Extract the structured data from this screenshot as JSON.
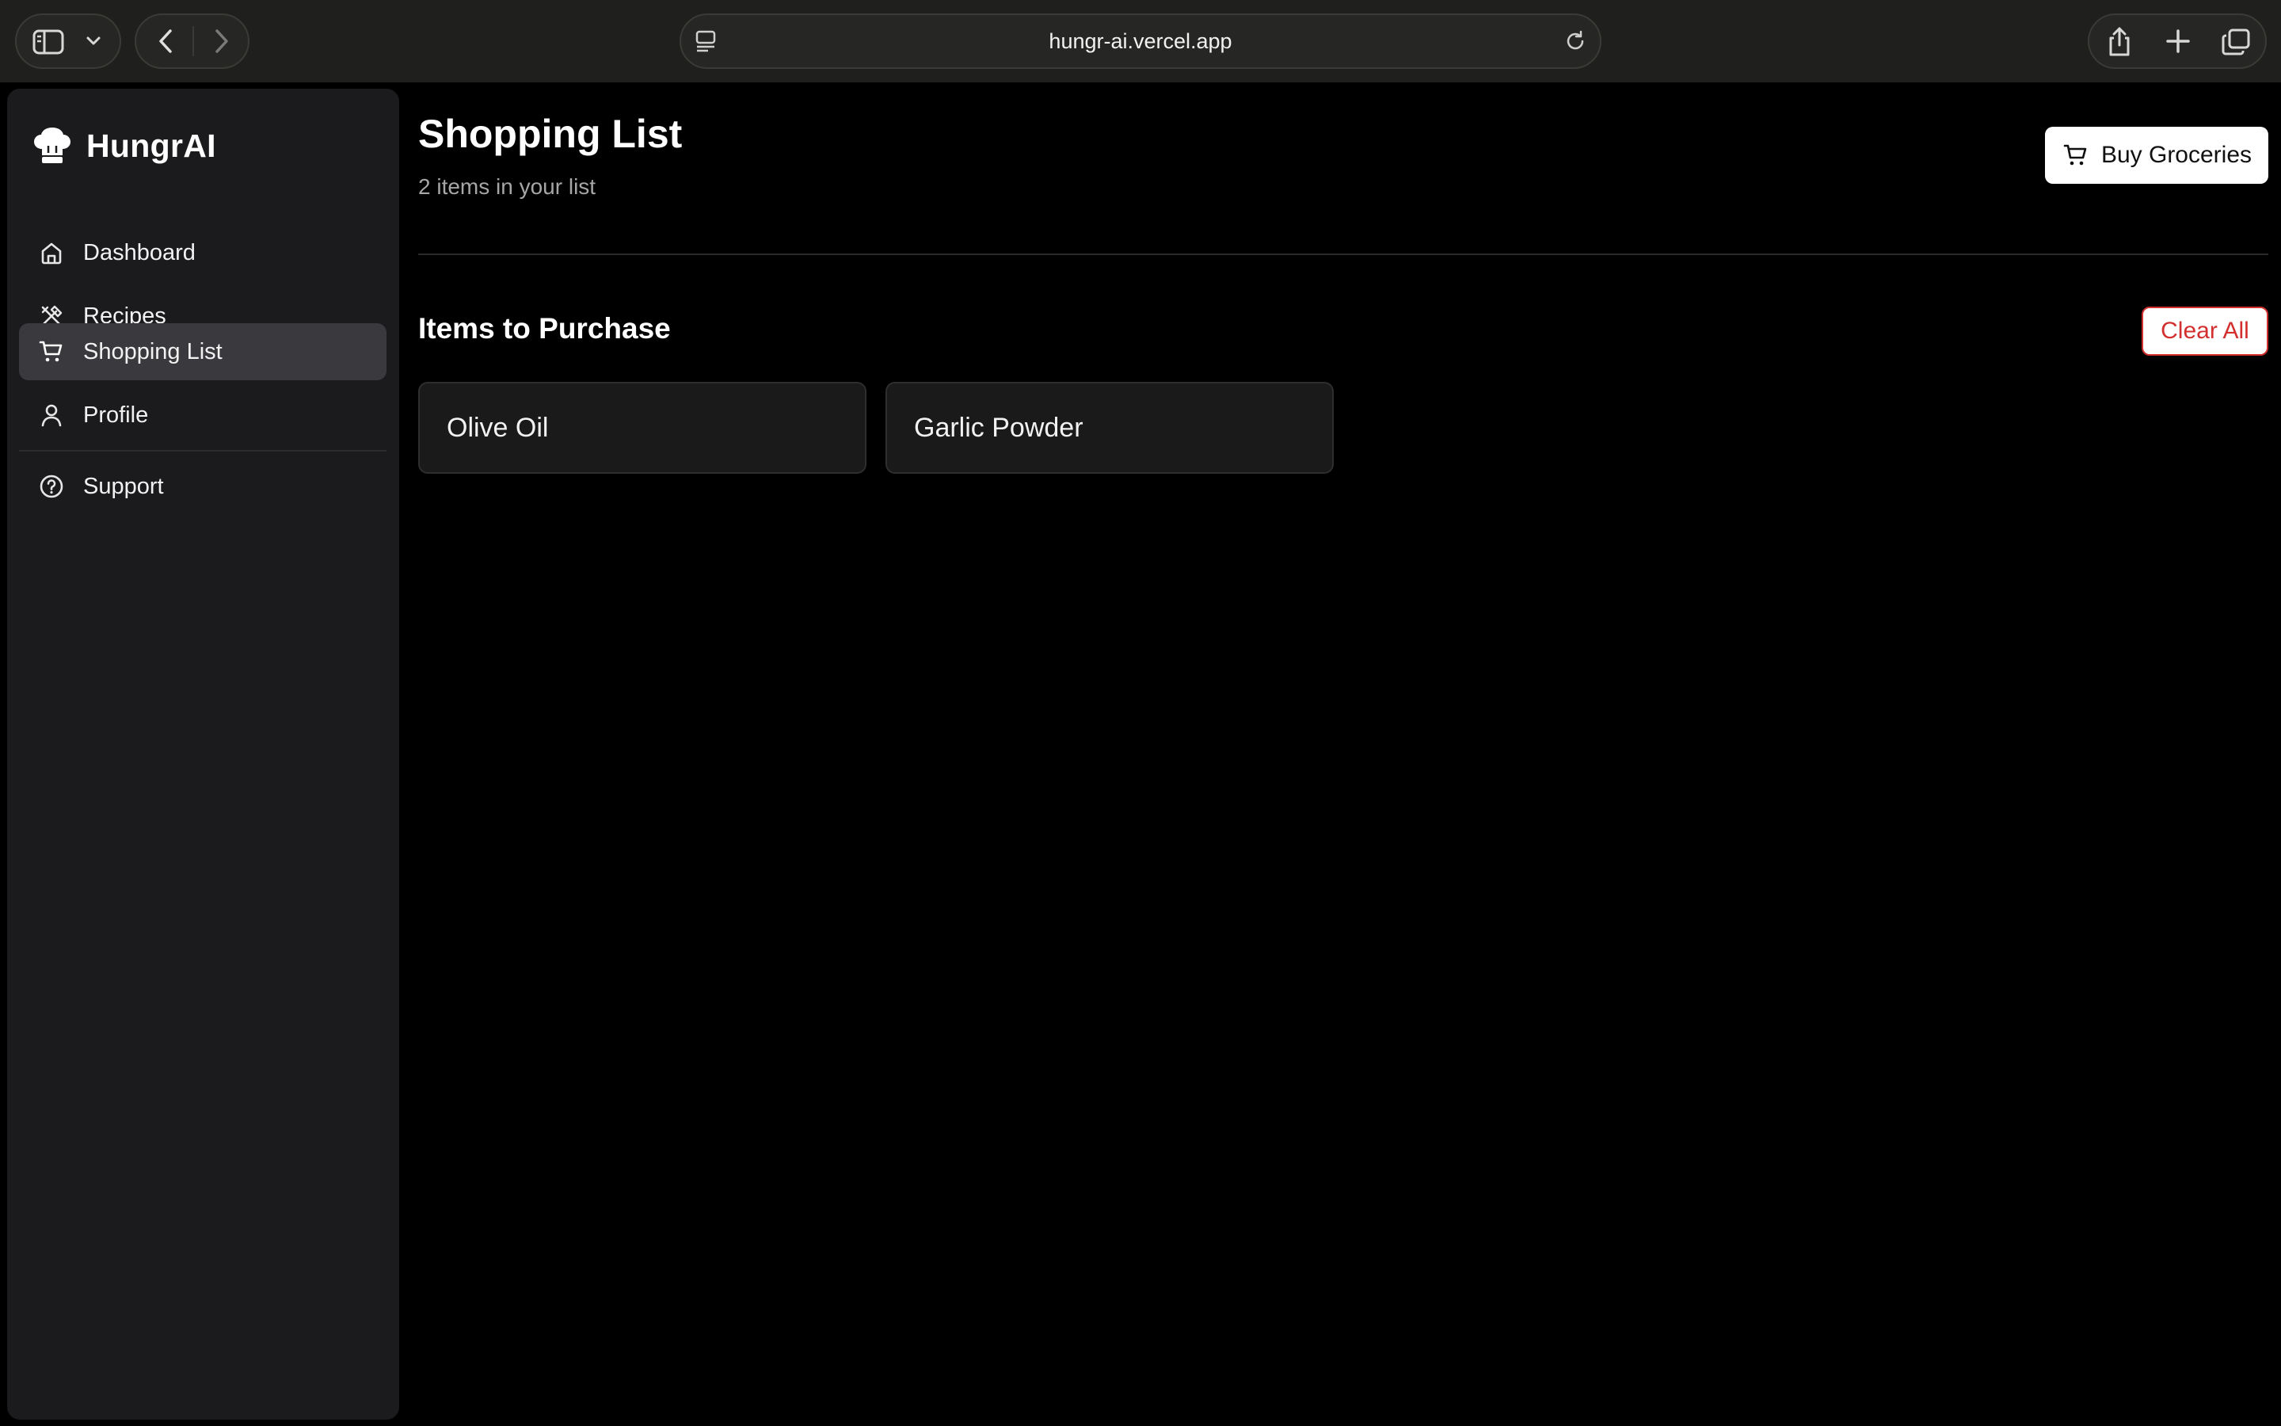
{
  "browser": {
    "url": "hungr-ai.vercel.app",
    "icons": [
      "sidebar-toggle-icon",
      "chevron-down-icon",
      "back-icon",
      "forward-icon",
      "page-menu-icon",
      "reload-icon",
      "share-icon",
      "new-tab-icon",
      "tabs-overview-icon"
    ]
  },
  "sidebar": {
    "brand": "HungrAI",
    "brand_icon": "chef-hat-icon",
    "items": [
      {
        "label": "Dashboard",
        "icon": "home-icon"
      },
      {
        "label": "Recipes",
        "icon": "utensils-icon"
      },
      {
        "label": "Shopping List",
        "icon": "cart-icon",
        "active": true
      },
      {
        "label": "Profile",
        "icon": "user-icon"
      }
    ],
    "footer_items": [
      {
        "label": "Support",
        "icon": "help-circle-icon"
      }
    ]
  },
  "main": {
    "title": "Shopping List",
    "subtitle": "2 items in your list",
    "buy_button": "Buy Groceries",
    "section_title": "Items to Purchase",
    "clear_button": "Clear All",
    "items": [
      "Olive Oil",
      "Garlic Powder"
    ]
  },
  "colors": {
    "background": "#000000",
    "sidebar": "#1b1b1d",
    "active_nav": "#3a3a3e",
    "danger": "#d32f2f"
  }
}
